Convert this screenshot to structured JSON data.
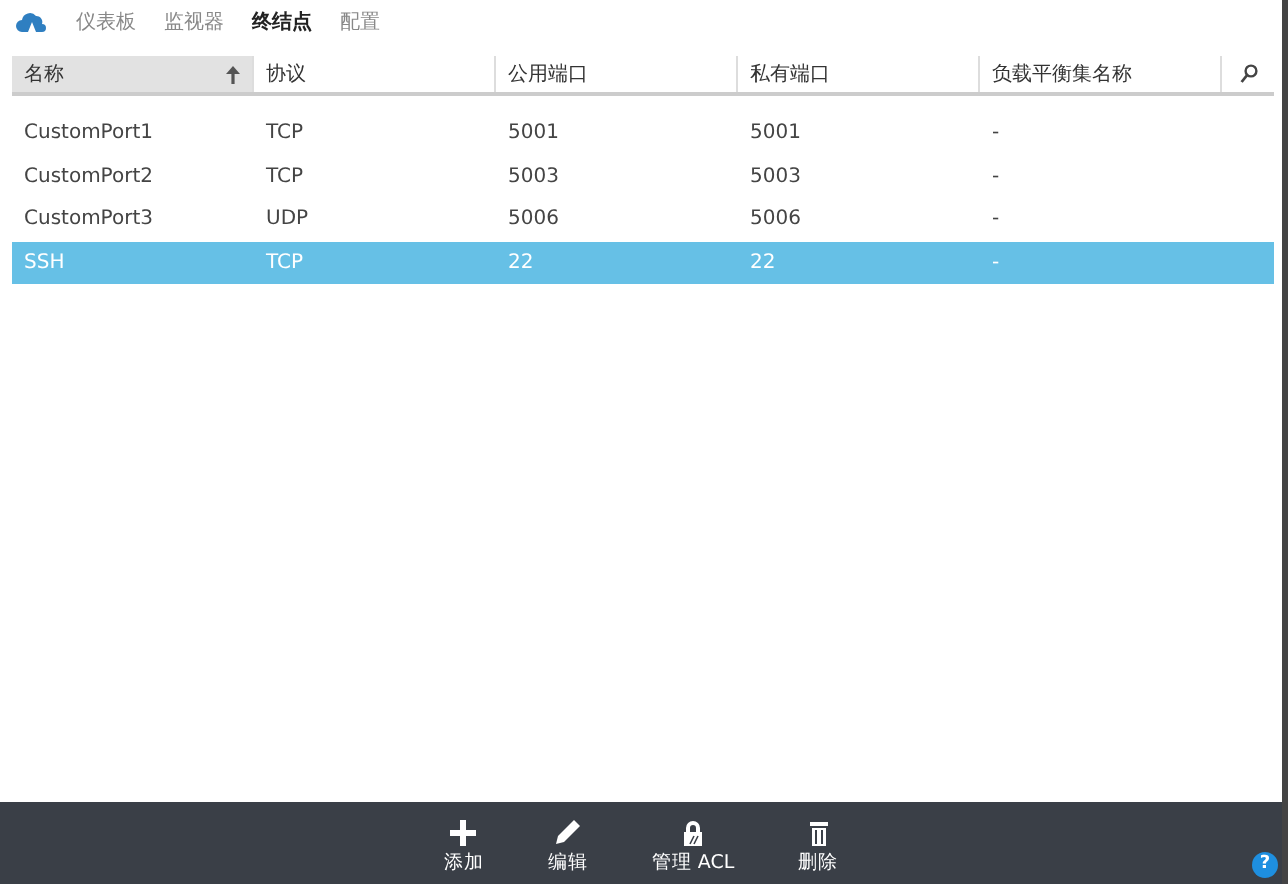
{
  "nav": {
    "tabs": [
      {
        "label": "仪表板",
        "selected": false
      },
      {
        "label": "监视器",
        "selected": false
      },
      {
        "label": "终结点",
        "selected": true
      },
      {
        "label": "配置",
        "selected": false
      }
    ]
  },
  "table": {
    "columns": [
      {
        "label": "名称",
        "sorted": true
      },
      {
        "label": "协议",
        "sorted": false
      },
      {
        "label": "公用端口",
        "sorted": false
      },
      {
        "label": "私有端口",
        "sorted": false
      },
      {
        "label": "负载平衡集名称",
        "sorted": false
      }
    ],
    "rows": [
      {
        "cells": [
          "CustomPort1",
          "TCP",
          "5001",
          "5001",
          "-"
        ],
        "selected": false
      },
      {
        "cells": [
          "CustomPort2",
          "TCP",
          "5003",
          "5003",
          "-"
        ],
        "selected": false
      },
      {
        "cells": [
          "CustomPort3",
          "UDP",
          "5006",
          "5006",
          "-"
        ],
        "selected": false
      },
      {
        "cells": [
          "SSH",
          "TCP",
          "22",
          "22",
          "-"
        ],
        "selected": true
      }
    ]
  },
  "command_bar": {
    "buttons": [
      {
        "kind": "add",
        "label": "添加"
      },
      {
        "kind": "edit",
        "label": "编辑"
      },
      {
        "kind": "lock",
        "label": "管理 ACL"
      },
      {
        "kind": "delete",
        "label": "删除"
      }
    ],
    "help": "?"
  }
}
